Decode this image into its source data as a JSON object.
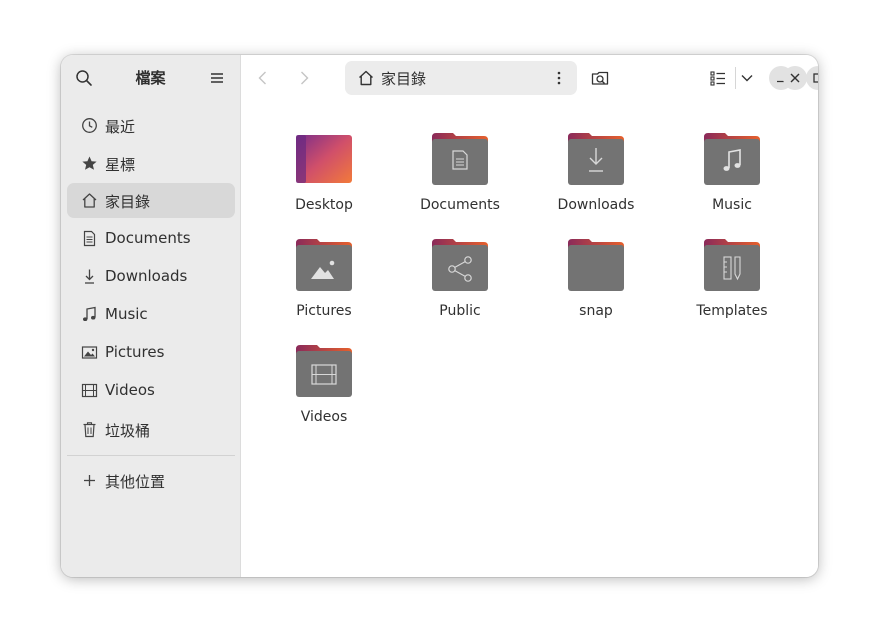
{
  "sidebar": {
    "title": "檔案",
    "items": [
      {
        "label": "最近",
        "icon": "clock-icon"
      },
      {
        "label": "星標",
        "icon": "star-icon"
      },
      {
        "label": "家目錄",
        "icon": "home-icon",
        "active": true
      },
      {
        "label": "Documents",
        "icon": "document-icon"
      },
      {
        "label": "Downloads",
        "icon": "download-icon"
      },
      {
        "label": "Music",
        "icon": "music-icon"
      },
      {
        "label": "Pictures",
        "icon": "picture-icon"
      },
      {
        "label": "Videos",
        "icon": "film-icon"
      },
      {
        "label": "垃圾桶",
        "icon": "trash-icon"
      }
    ],
    "other_locations": "其他位置"
  },
  "header": {
    "path_label": "家目錄"
  },
  "files": [
    {
      "name": "Desktop",
      "icon": "desktop-folder-icon"
    },
    {
      "name": "Documents",
      "icon": "documents-folder-icon"
    },
    {
      "name": "Downloads",
      "icon": "downloads-folder-icon"
    },
    {
      "name": "Music",
      "icon": "music-folder-icon"
    },
    {
      "name": "Pictures",
      "icon": "pictures-folder-icon"
    },
    {
      "name": "Public",
      "icon": "public-folder-icon"
    },
    {
      "name": "snap",
      "icon": "folder-icon"
    },
    {
      "name": "Templates",
      "icon": "templates-folder-icon"
    },
    {
      "name": "Videos",
      "icon": "videos-folder-icon"
    }
  ],
  "colors": {
    "folder_body": "#737373",
    "folder_tab_start": "#8a2a5a",
    "folder_tab_end": "#e6602c",
    "desktop_start": "#7a2d8a",
    "desktop_end": "#f27a3a"
  }
}
